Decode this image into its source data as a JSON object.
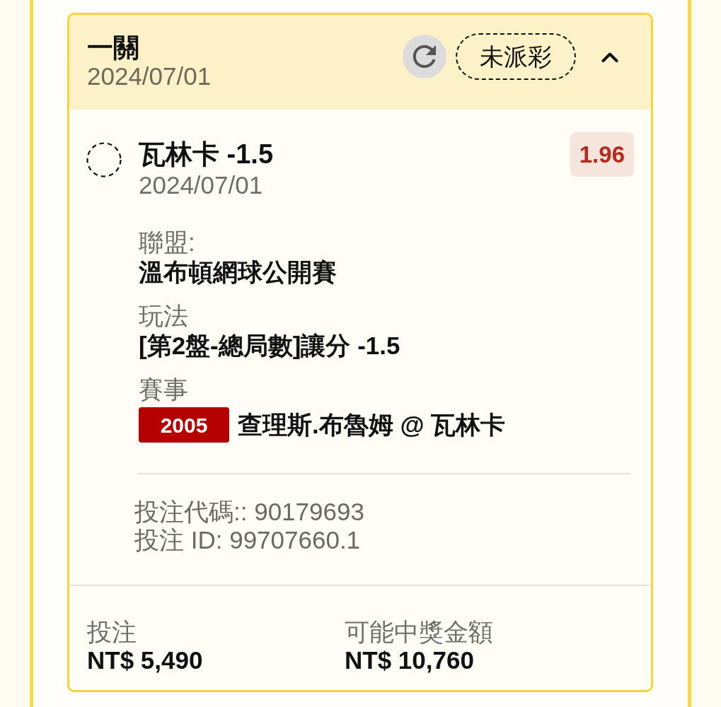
{
  "bet_card": {
    "header": {
      "title": "一關",
      "date": "2024/07/01",
      "status": "未派彩",
      "expanded": true
    },
    "selection": {
      "title": "瓦林卡 -1.5",
      "date": "2024/07/01",
      "odds": "1.96",
      "details": [
        {
          "kind": "text",
          "label": "聯盟:",
          "value": "溫布頓網球公開賽"
        },
        {
          "kind": "text",
          "label": "玩法",
          "value": "[第2盤-總局數]讓分 -1.5"
        },
        {
          "kind": "event",
          "label": "賽事",
          "event_code": "2005",
          "value": "查理斯.布魯姆 @ 瓦林卡"
        }
      ],
      "bet_code": "投注代碼:: 90179693",
      "bet_id": "投注 ID: 99707660.1"
    },
    "summary": [
      {
        "label": "投注",
        "value": "NT$ 5,490"
      },
      {
        "label": "可能中獎金額",
        "value": "NT$ 10,760"
      }
    ]
  }
}
